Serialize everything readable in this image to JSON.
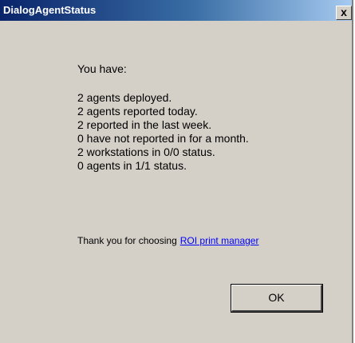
{
  "window": {
    "title": "DialogAgentStatus",
    "close_label": "x"
  },
  "message": {
    "intro": "You have:",
    "lines": [
      "2 agents deployed.",
      "2 agents reported today.",
      "2 reported in the last week.",
      "0 have not reported in for a month.",
      "2 workstations in 0/0 status.",
      "0 agents in 1/1 status."
    ]
  },
  "footer": {
    "thanks_text": "Thank you for choosing",
    "link_text": "ROI print manager"
  },
  "buttons": {
    "ok_label": "OK"
  },
  "colors": {
    "dialog_background": "#d4d0c8",
    "titlebar_start": "#0a246a",
    "titlebar_end": "#a6caf0",
    "link": "#0000ff"
  }
}
